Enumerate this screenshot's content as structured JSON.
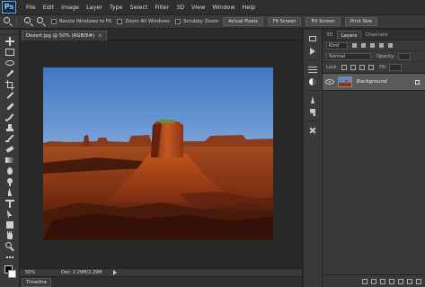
{
  "app": {
    "logo": "Ps"
  },
  "menu": [
    "File",
    "Edit",
    "Image",
    "Layer",
    "Type",
    "Select",
    "Filter",
    "3D",
    "View",
    "Window",
    "Help"
  ],
  "options": {
    "checkboxes": [
      "Resize Windows to Fit",
      "Zoom All Windows",
      "Scrubby Zoom"
    ],
    "buttons": [
      "Actual Pixels",
      "Fit Screen",
      "Fill Screen",
      "Print Size"
    ]
  },
  "document": {
    "tab_title": "Desert.jpg @ 50% (RGB/8#)",
    "close": "×",
    "zoom": "50%",
    "doc_info": "Doc: 2.29M/2.29M",
    "timeline_label": "Timeline"
  },
  "panel": {
    "tabs": [
      "3D",
      "Layers",
      "Channels"
    ],
    "active_tab": "Layers",
    "kind_label": "Kind",
    "blend_mode": "Normal",
    "opacity_label": "Opacity:",
    "lock_label": "Lock:",
    "fill_label": "Fill:",
    "layers": [
      {
        "name": "Background",
        "visible": true,
        "locked": true
      }
    ]
  },
  "colors": {
    "menu_bg": "#2f2f2f",
    "panel_bg": "#3a3a3a",
    "canvas_bg": "#282828",
    "accent": "#5fa8e8"
  }
}
